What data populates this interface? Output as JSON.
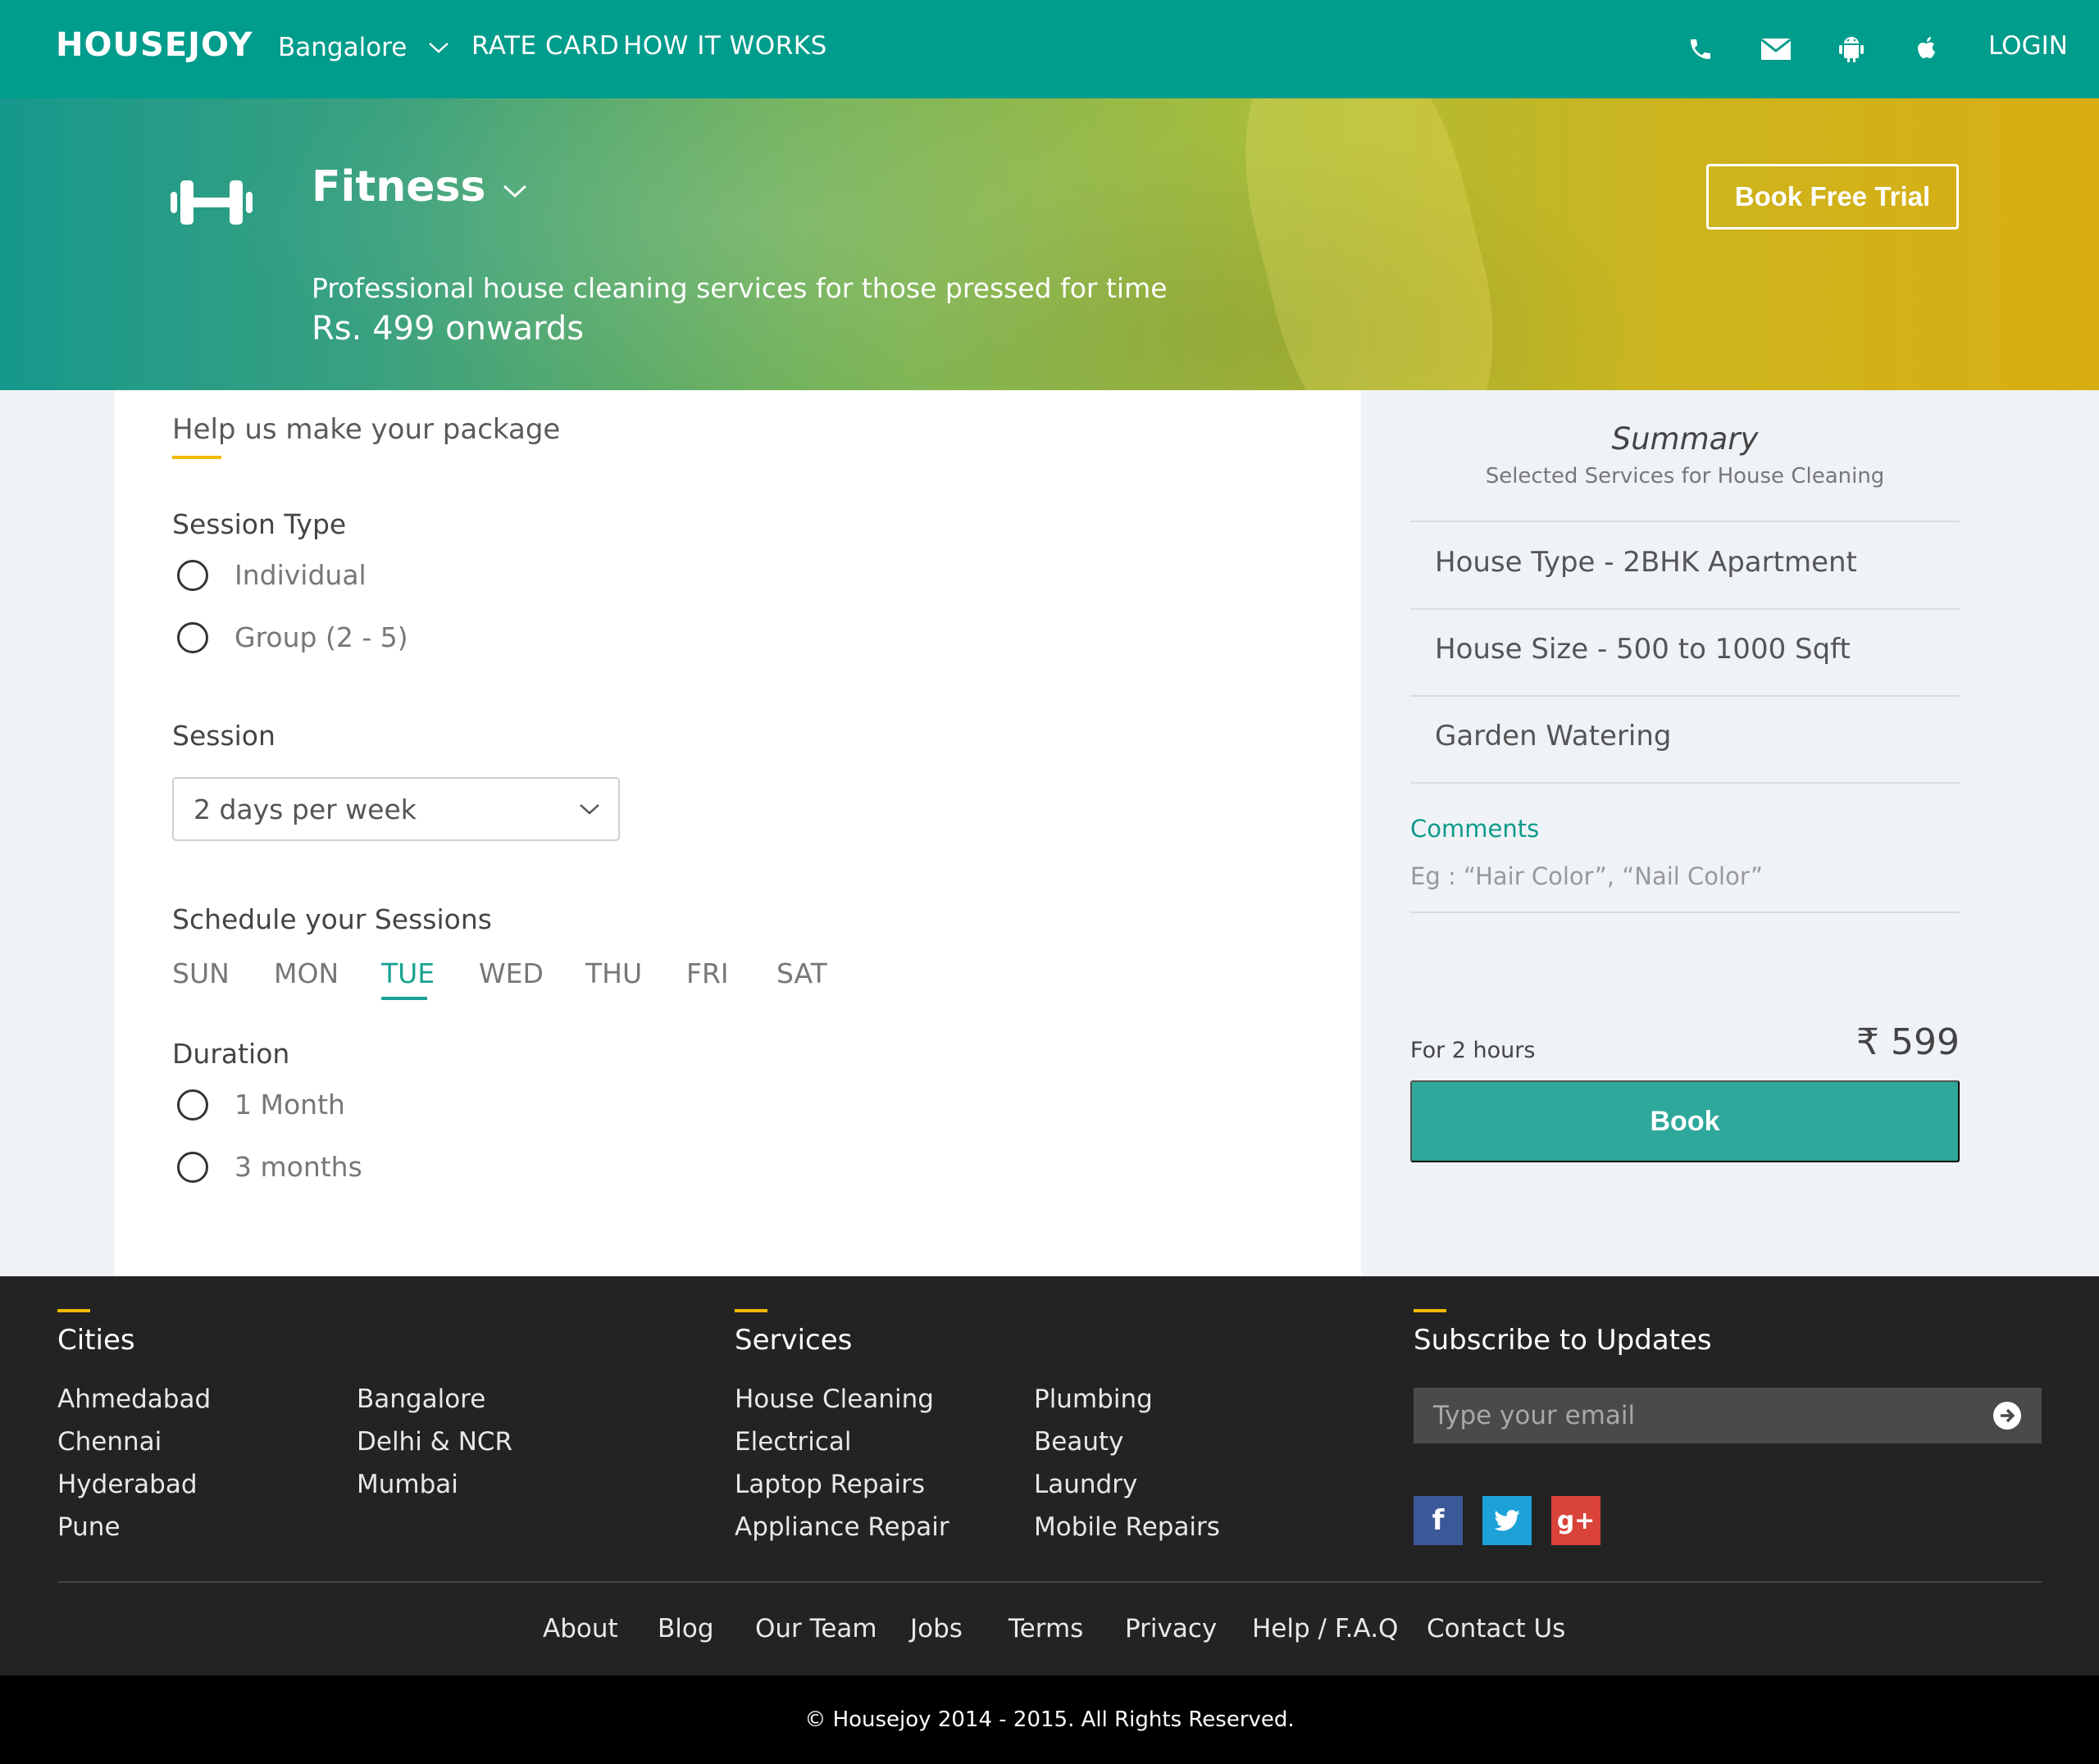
{
  "nav": {
    "logo": "HOUSEJOY",
    "city": "Bangalore",
    "links": [
      "RATE CARD",
      "HOW IT WORKS"
    ],
    "icons": [
      "phone-icon",
      "mail-icon",
      "android-icon",
      "apple-icon"
    ],
    "login": "LOGIN"
  },
  "hero": {
    "service": "Fitness",
    "tagline": "Professional house cleaning services for those pressed for time",
    "price": "Rs. 499 onwards",
    "trial_button": "Book Free Trial"
  },
  "form": {
    "title": "Help us make your package",
    "session_type_label": "Session Type",
    "session_types": [
      "Individual",
      "Group (2 - 5)"
    ],
    "session_label": "Session",
    "session_value": "2 days per week",
    "schedule_label": "Schedule your Sessions",
    "days": [
      "SUN",
      "MON",
      "TUE",
      "WED",
      "THU",
      "FRI",
      "SAT"
    ],
    "selected_day": "TUE",
    "duration_label": "Duration",
    "durations": [
      "1 Month",
      "3 months"
    ]
  },
  "summary": {
    "title": "Summary",
    "subtitle": "Selected Services for House Cleaning",
    "items": [
      "House Type - 2BHK Apartment",
      "House Size - 500 to 1000 Sqft",
      "Garden Watering"
    ],
    "comments_label": "Comments",
    "comments_placeholder": "Eg : “Hair Color”, “Nail Color”",
    "hours": "For 2 hours",
    "amount": "₹ 599",
    "book_button": "Book"
  },
  "footer": {
    "cities_title": "Cities",
    "cities_col1": [
      "Ahmedabad",
      "Chennai",
      "Hyderabad",
      "Pune"
    ],
    "cities_col2": [
      "Bangalore",
      "Delhi & NCR",
      "Mumbai"
    ],
    "services_title": "Services",
    "services_col1": [
      "House Cleaning",
      "Electrical",
      "Laptop Repairs",
      "Appliance Repair"
    ],
    "services_col2": [
      "Plumbing",
      "Beauty",
      "Laundry",
      "Mobile Repairs"
    ],
    "subscribe_title": "Subscribe to Updates",
    "email_placeholder": "Type your email",
    "social": [
      "f",
      "twitter",
      "g+"
    ],
    "bottom_links": [
      "About",
      "Blog",
      "Our Team",
      "Jobs",
      "Terms",
      "Privacy",
      "Help / F.A.Q",
      "Contact Us"
    ],
    "copyright": "© Housejoy 2014 - 2015. All Rights Reserved."
  },
  "colors": {
    "brand": "#009c8c",
    "accent": "#1aa394",
    "book": "#2ea89b",
    "underline": "#f5b900",
    "facebook": "#3b5998",
    "twitter": "#1da1d9",
    "google": "#d9433a"
  }
}
